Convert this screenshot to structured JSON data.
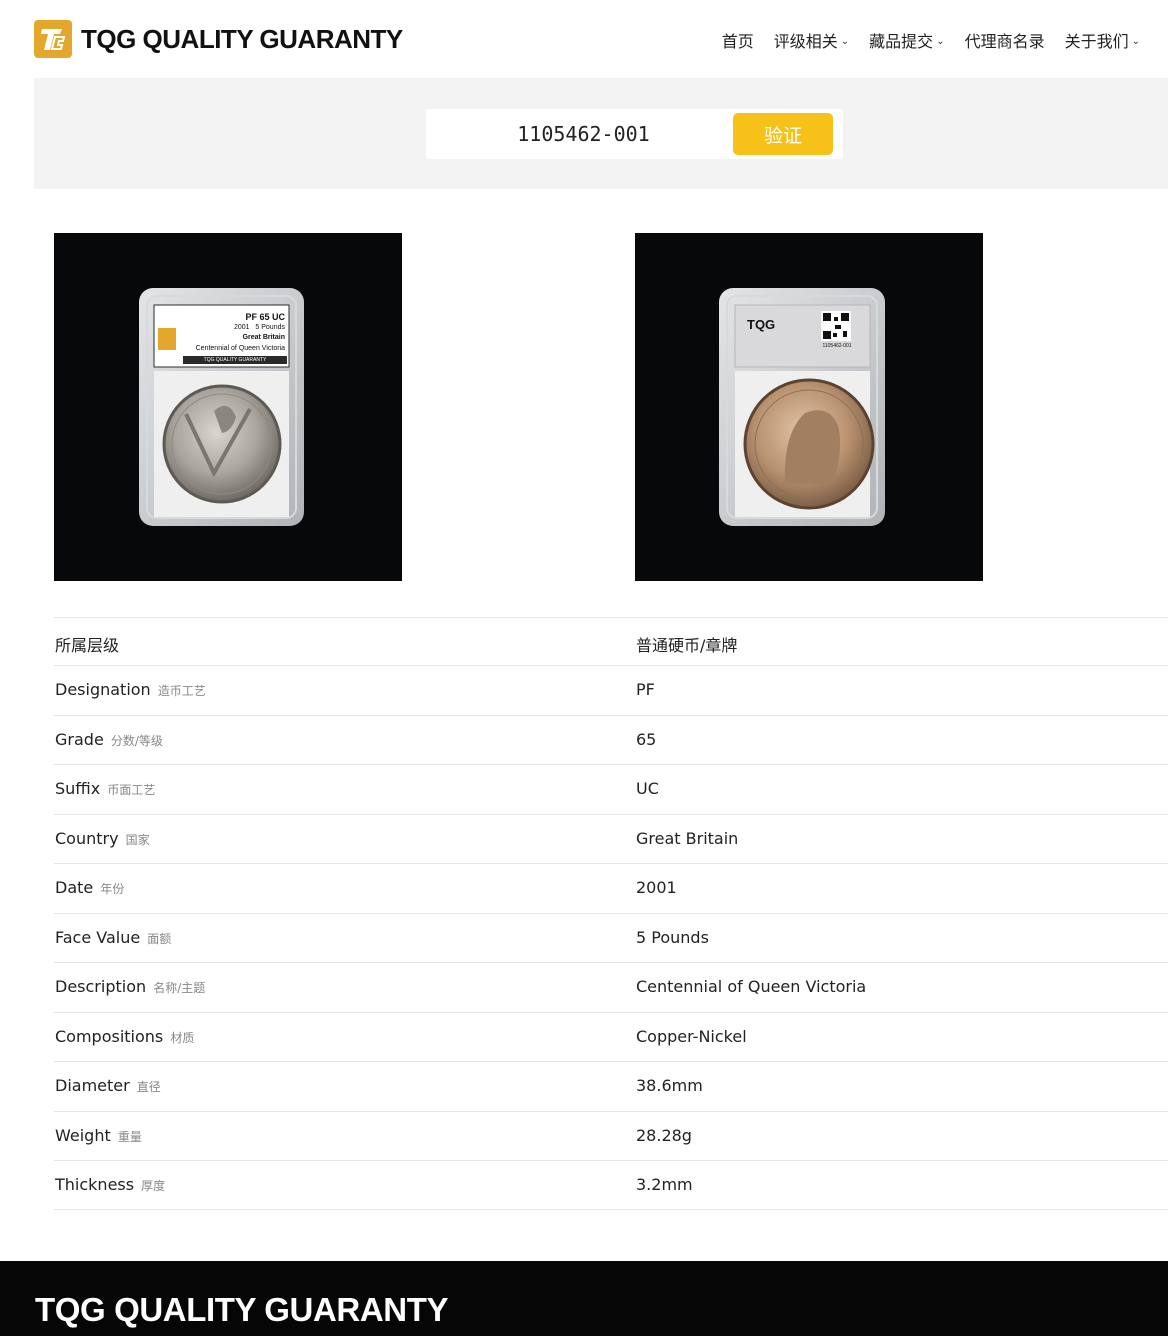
{
  "brand": {
    "name": "TQG QUALITY GUARANTY"
  },
  "nav": [
    {
      "label": "首页",
      "dropdown": false
    },
    {
      "label": "评级相关",
      "dropdown": true
    },
    {
      "label": "藏品提交",
      "dropdown": true
    },
    {
      "label": "代理商名录",
      "dropdown": false
    },
    {
      "label": "关于我们",
      "dropdown": true
    }
  ],
  "search": {
    "value": "1105462-001",
    "button_label": "验证"
  },
  "slab_front": {
    "grade_line": "PF 65 UC",
    "year": "2001",
    "denomination": "5 Pounds",
    "country": "Great Britain",
    "description": "Centennial of Queen Victoria",
    "footer": "TQG QUALITY GUARANTY"
  },
  "slab_back": {
    "logo": "TQG",
    "cert_no": "1105462-001"
  },
  "specs": {
    "category": {
      "label": "所属层级",
      "value": "普通硬币/章牌"
    },
    "rows": [
      {
        "label": "Designation",
        "label_cn": "造币工艺",
        "value": "PF"
      },
      {
        "label": "Grade",
        "label_cn": "分数/等级",
        "value": "65"
      },
      {
        "label": "Suffix",
        "label_cn": "币面工艺",
        "value": "UC"
      },
      {
        "label": "Country",
        "label_cn": "国家",
        "value": "Great Britain"
      },
      {
        "label": "Date",
        "label_cn": "年份",
        "value": "2001"
      },
      {
        "label": "Face Value",
        "label_cn": "面额",
        "value": "5 Pounds"
      },
      {
        "label": "Description",
        "label_cn": "名称/主题",
        "value": "Centennial of Queen Victoria"
      },
      {
        "label": "Compositions",
        "label_cn": "材质",
        "value": "Copper-Nickel"
      },
      {
        "label": "Diameter",
        "label_cn": "直径",
        "value": "38.6mm"
      },
      {
        "label": "Weight",
        "label_cn": "重量",
        "value": "28.28g"
      },
      {
        "label": "Thickness",
        "label_cn": "厚度",
        "value": "3.2mm"
      }
    ]
  },
  "footer": {
    "title": "TQG QUALITY GUARANTY"
  },
  "colors": {
    "accent": "#f6c21a",
    "logo_bg": "#e3a82b",
    "footer_bg": "#060606",
    "band_bg": "#f3f3f3"
  },
  "icons": [
    "tqg-logo-icon",
    "chevron-down-icon"
  ]
}
